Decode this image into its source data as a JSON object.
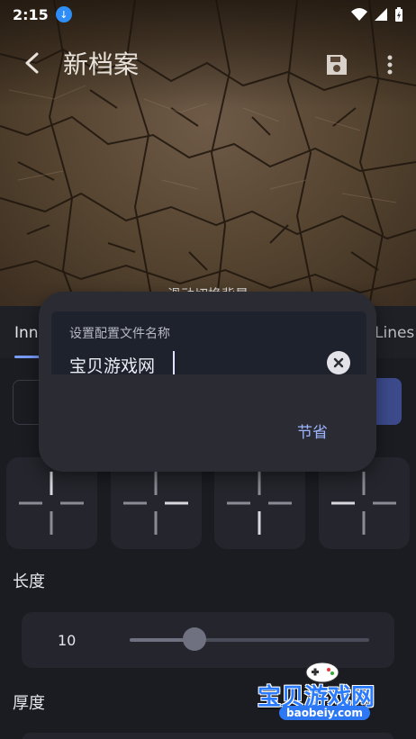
{
  "status_bar": {
    "time": "2:15"
  },
  "app_bar": {
    "title": "新档案",
    "back_icon": "back-arrow-icon",
    "save_icon": "save-icon",
    "more_icon": "more-vert-icon"
  },
  "hero": {
    "caption": "滑动切换背景"
  },
  "tabs": {
    "inner": "Inn",
    "lines": "Lines"
  },
  "sections": {
    "length_label": "长度",
    "thickness_label": "厚度"
  },
  "slider": {
    "value": "10",
    "fraction": 0.27
  },
  "dialog": {
    "field_label": "设置配置文件名称",
    "field_value": "宝贝游戏网",
    "save_label": "节省"
  },
  "watermark": {
    "text": "宝贝游戏网",
    "url": "baobeiy.com"
  },
  "colors": {
    "accent": "#7a9cff",
    "dialog_bg": "#2b2c33",
    "page_bg": "#1b1c22"
  }
}
